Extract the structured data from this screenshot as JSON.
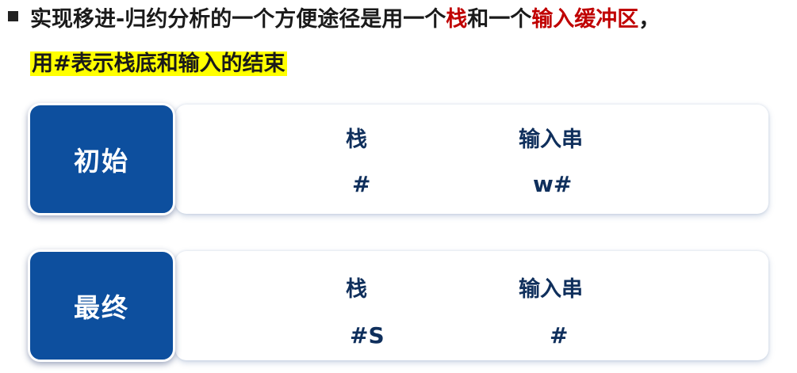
{
  "intro": {
    "line1": {
      "part1": "实现移进-归约分析的一个方便途径是用一个",
      "highlight1": "栈",
      "part2": "和一个",
      "highlight2": "输入缓冲区",
      "part3": "，"
    },
    "line2": "用#表示栈底和输入的结束"
  },
  "rows": [
    {
      "label": "初始",
      "stack_header": "栈",
      "input_header": "输入串",
      "stack_value": "#",
      "input_value": "w#"
    },
    {
      "label": "最终",
      "stack_header": "栈",
      "input_header": "输入串",
      "stack_value": "#S",
      "input_value": "#"
    }
  ],
  "colors": {
    "label_bg": "#0d4f9e",
    "text_dark_blue": "#0f2f5c",
    "emphasis_red": "#c00000",
    "highlight_yellow": "#ffff00"
  }
}
